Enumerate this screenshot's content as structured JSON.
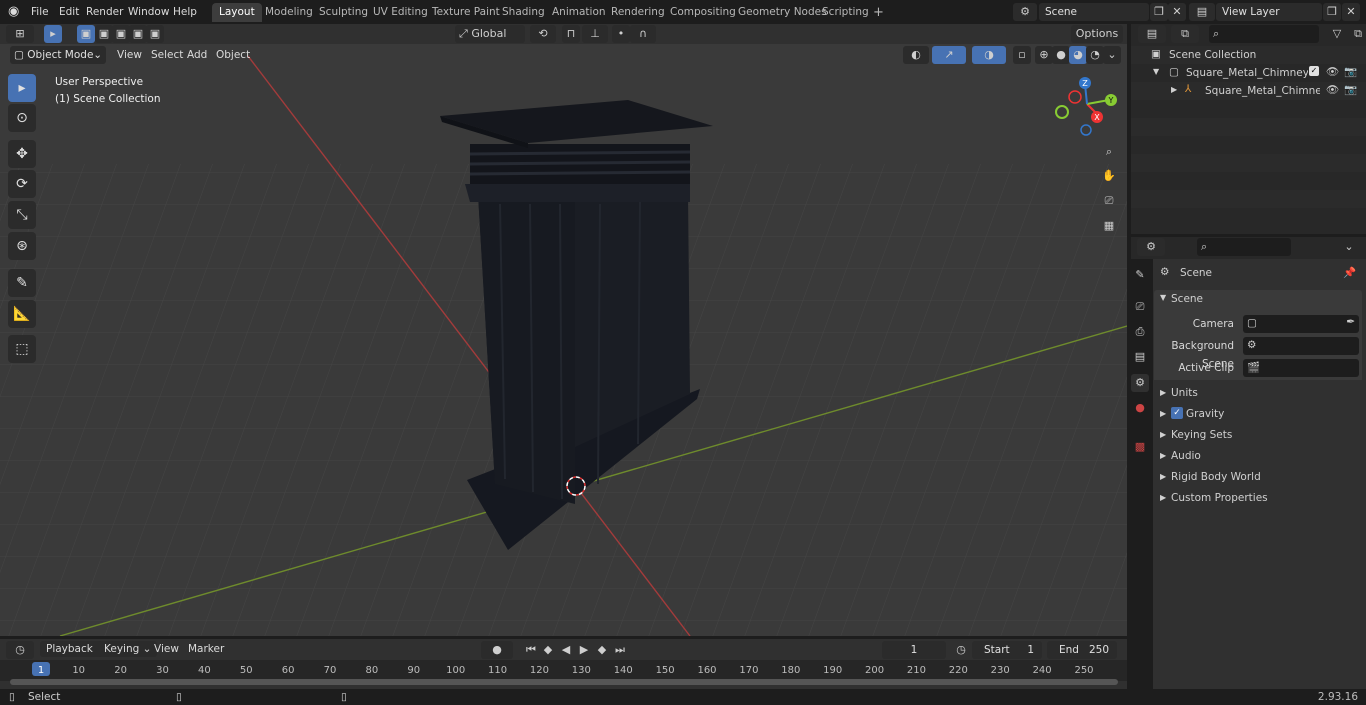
{
  "topbar": {
    "menus": [
      "File",
      "Edit",
      "Render",
      "Window",
      "Help"
    ],
    "workspaces": [
      "Layout",
      "Modeling",
      "Sculpting",
      "UV Editing",
      "Texture Paint",
      "Shading",
      "Animation",
      "Rendering",
      "Compositing",
      "Geometry Nodes",
      "Scripting"
    ],
    "active_workspace": "Layout",
    "scene_name": "Scene",
    "view_layer": "View Layer"
  },
  "viewport_header": {
    "mode": "Object Mode",
    "menus": [
      "View",
      "Select",
      "Add",
      "Object"
    ],
    "orientation": "Global",
    "options_label": "Options"
  },
  "viewport": {
    "perspective_label": "User Perspective",
    "collection_label": "(1) Scene Collection",
    "gizmo_axes": [
      "X",
      "Y",
      "Z"
    ]
  },
  "outliner": {
    "root": "Scene Collection",
    "items": [
      {
        "label": "Square_Metal_Chimney_Black",
        "type": "collection"
      },
      {
        "label": "Square_Metal_Chimney_",
        "type": "object"
      }
    ]
  },
  "properties": {
    "context": "Scene",
    "panel_title": "Scene",
    "fields": [
      {
        "label": "Camera"
      },
      {
        "label": "Background Scene"
      },
      {
        "label": "Active Clip"
      }
    ],
    "sections": [
      "Units",
      "Gravity",
      "Keying Sets",
      "Audio",
      "Rigid Body World",
      "Custom Properties"
    ],
    "gravity_checked": true
  },
  "timeline": {
    "menus": [
      "Playback",
      "Keying",
      "View",
      "Marker"
    ],
    "current_frame": "1",
    "start_label": "Start",
    "start_value": "1",
    "end_label": "End",
    "end_value": "250",
    "ruler": [
      "1",
      "10",
      "20",
      "30",
      "40",
      "50",
      "60",
      "70",
      "80",
      "90",
      "100",
      "110",
      "120",
      "130",
      "140",
      "150",
      "160",
      "170",
      "180",
      "190",
      "200",
      "210",
      "220",
      "230",
      "240",
      "250"
    ]
  },
  "statusbar": {
    "left_label": "Select",
    "version": "2.93.16"
  },
  "colors": {
    "accent": "#4772b3",
    "x_axis": "#a33b3b",
    "y_axis": "#6e8b2c"
  }
}
